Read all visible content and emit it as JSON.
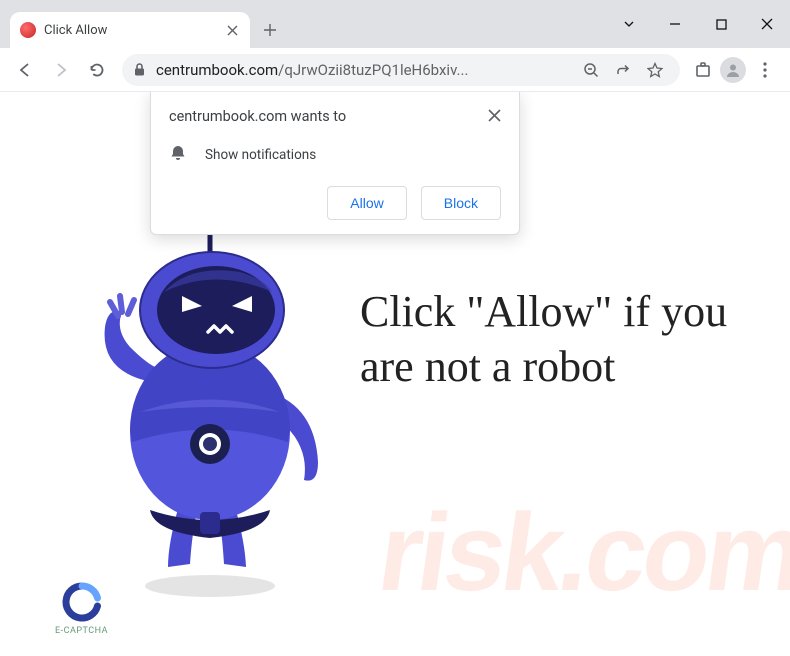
{
  "tab": {
    "title": "Click Allow"
  },
  "addressbar": {
    "domain": "centrumbook.com",
    "path": "/qJrwOzii8tuzPQ1leH6bxiv..."
  },
  "notification": {
    "origin_text": "centrumbook.com wants to",
    "permission_label": "Show notifications",
    "allow_label": "Allow",
    "block_label": "Block"
  },
  "page": {
    "headline": "Click \"Allow\" if you are not a robot",
    "captcha_label": "E-CAPTCHA"
  },
  "watermark": {
    "text": "risk.com"
  },
  "colors": {
    "robot_primary": "#4a4bd0",
    "robot_dark": "#2b2c8e",
    "accent_blue": "#1a73e8"
  }
}
